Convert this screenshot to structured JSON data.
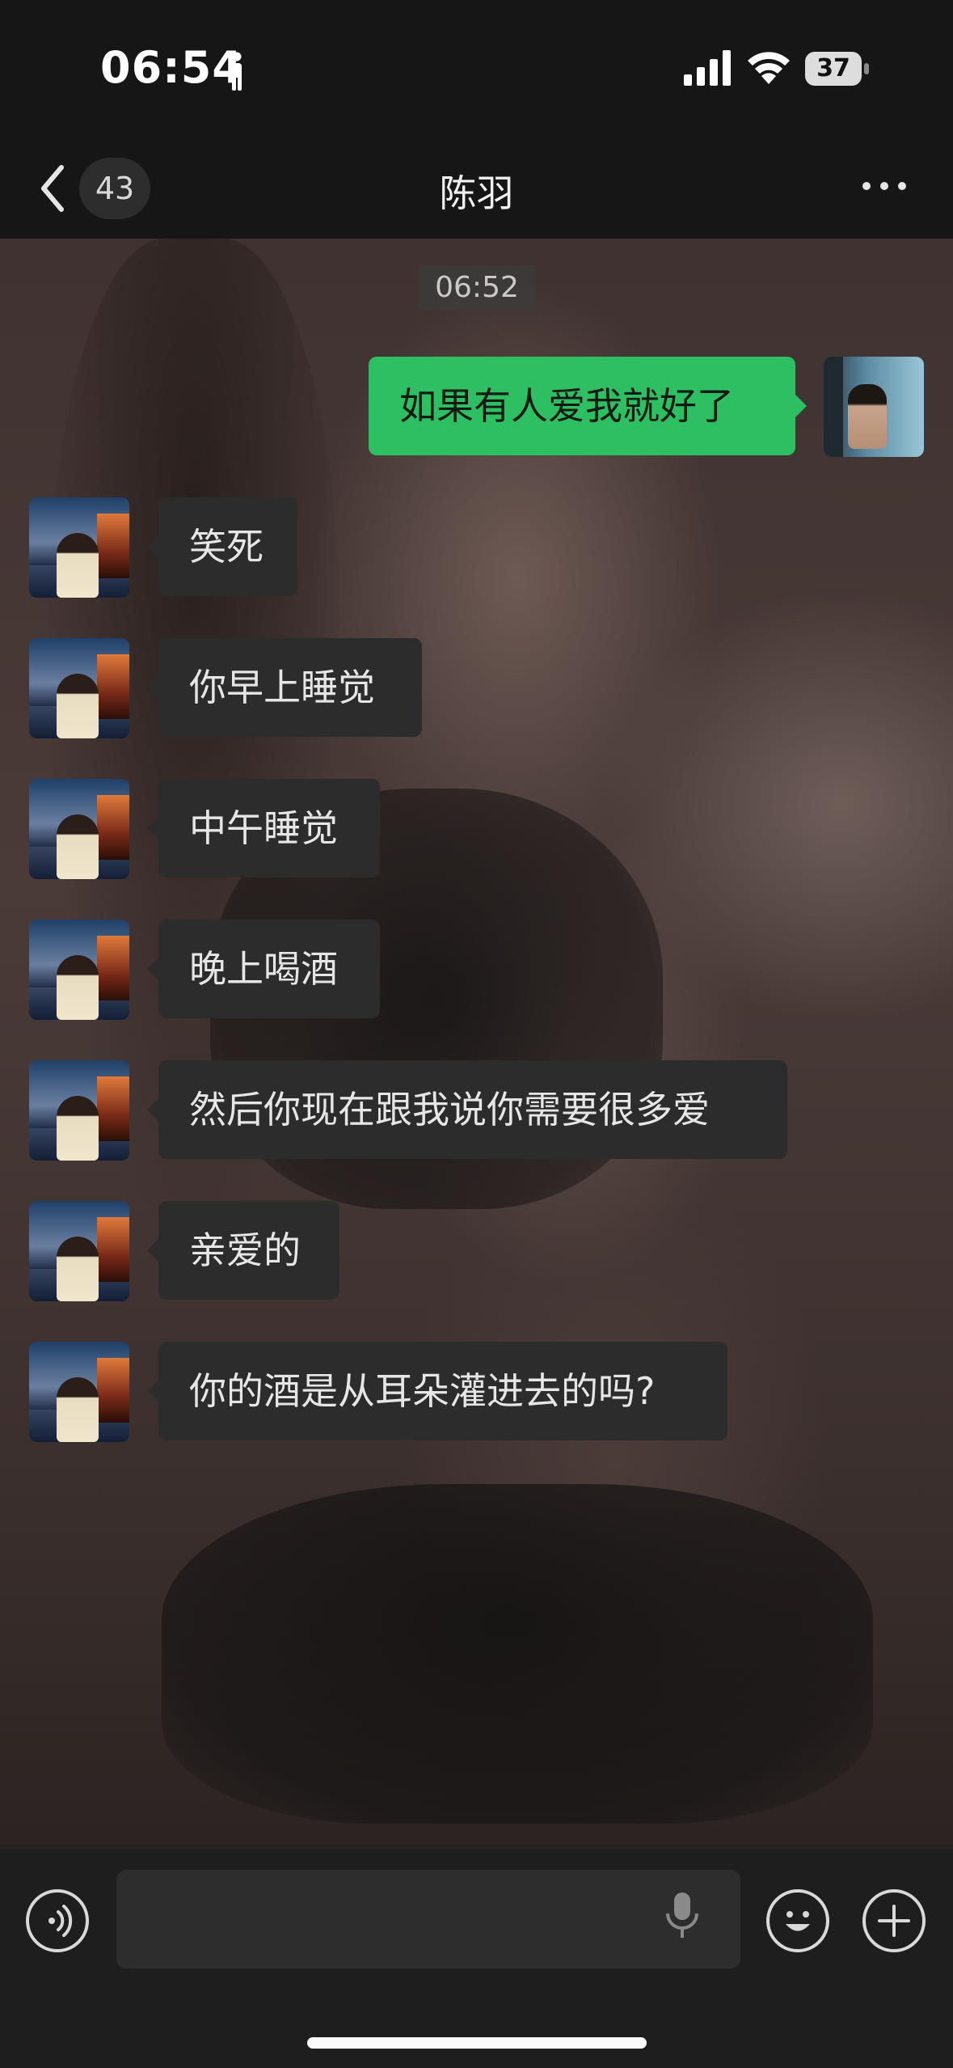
{
  "status_bar": {
    "time": "06:54",
    "battery": "37",
    "icons": [
      "person-icon",
      "signal-icon",
      "wifi-icon",
      "battery-icon"
    ]
  },
  "nav": {
    "unread_count": "43",
    "title": "陈羽",
    "icons": [
      "back-chevron-icon",
      "more-icon"
    ]
  },
  "chat": {
    "timestamp": "06:52",
    "messages": [
      {
        "from": "me",
        "text": "如果有人爱我就好了"
      },
      {
        "from": "contact",
        "text": "笑死"
      },
      {
        "from": "contact",
        "text": "你早上睡觉"
      },
      {
        "from": "contact",
        "text": "中午睡觉"
      },
      {
        "from": "contact",
        "text": "晚上喝酒"
      },
      {
        "from": "contact",
        "text": "然后你现在跟我说你需要很多爱"
      },
      {
        "from": "contact",
        "text": "亲爱的"
      },
      {
        "from": "contact",
        "text": "你的酒是从耳朵灌进去的吗?"
      }
    ]
  },
  "input_bar": {
    "value": "",
    "icons": [
      "voice-icon",
      "mic-icon",
      "emoji-icon",
      "plus-icon"
    ]
  },
  "colors": {
    "outgoing_bubble": "#2fbf63",
    "incoming_bubble": "#2c2c2c",
    "bar_background": "#161616"
  }
}
